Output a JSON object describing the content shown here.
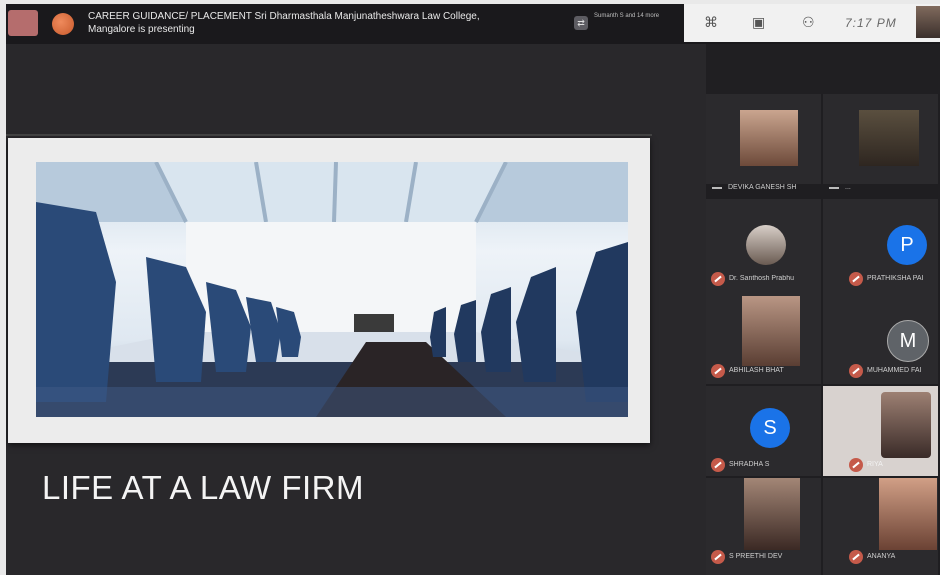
{
  "meeting": {
    "banner_title": "CAREER GUIDANCE/ PLACEMENT Sri Dharmasthala Manjunatheshwara Law College, Mangalore is presenting",
    "info_text": "Sumanth S and 14 more",
    "clock": "7:17 PM"
  },
  "slide": {
    "title": "LIFE AT A LAW FIRM"
  },
  "participants": [
    {
      "name": "DEVIKA GANESH SH",
      "type": "photo",
      "muted": false
    },
    {
      "name": "...",
      "type": "photo",
      "muted": false
    },
    {
      "name": "Dr. Santhosh Prabhu",
      "type": "photo",
      "muted": true
    },
    {
      "name": "PRATHIKSHA PAI",
      "type": "letter",
      "letter": "P",
      "color": "#1a73e8",
      "muted": true
    },
    {
      "name": "ABHILASH BHAT",
      "type": "photo",
      "muted": true
    },
    {
      "name": "MUHAMMED FAI",
      "type": "letter",
      "letter": "M",
      "color": "#5f6368",
      "muted": true
    },
    {
      "name": "SHRADHA S",
      "type": "letter",
      "letter": "S",
      "color": "#1a73e8",
      "muted": true
    },
    {
      "name": "RIYA",
      "type": "photo",
      "muted": true
    },
    {
      "name": "S PREETHI DEV",
      "type": "photo",
      "muted": true
    },
    {
      "name": "ANANYA",
      "type": "photo",
      "muted": true
    }
  ],
  "colors": {
    "accent_blue": "#1a73e8",
    "mic_red": "#c55a4a",
    "rec_orange": "#e07a46"
  }
}
